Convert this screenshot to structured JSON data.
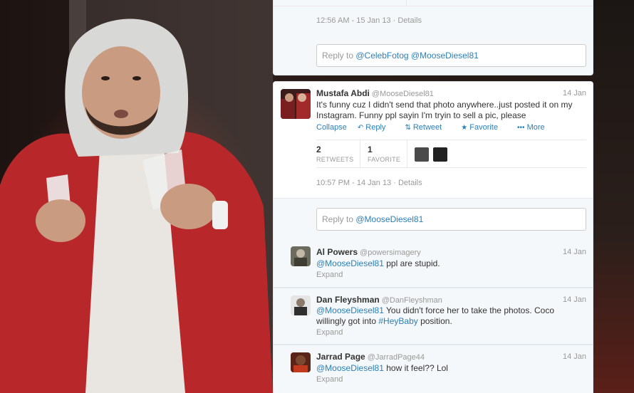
{
  "colors": {
    "link": "#2a7fb8",
    "muted": "#999999",
    "text": "#333333",
    "background_photo": "#3a1a16"
  },
  "top_tweet": {
    "timestamp": "12:56 AM - 15 Jan 13 · Details",
    "reply_prefix": "Reply to",
    "reply_mentions": "@CelebFotog @MooseDiesel81"
  },
  "main_tweet": {
    "name": "Mustafa Abdi",
    "handle": "@MooseDiesel81",
    "date": "14 Jan",
    "text_line1": "It's funny cuz I didn't send that photo anywhere..just posted it on my",
    "text_line2": "Instagram. Funny ppl sayin I'm tryin to sell a pic, please",
    "actions": {
      "collapse": "Collapse",
      "reply": "Reply",
      "retweet": "Retweet",
      "favorite": "Favorite",
      "more": "More"
    },
    "action_icons": [
      "reply-arrow-icon",
      "retweet-icon",
      "star-icon",
      "ellipsis-icon"
    ],
    "stats": {
      "retweets_count": "2",
      "retweets_label": "RETWEETS",
      "favorites_count": "1",
      "favorites_label": "FAVORITE"
    },
    "timestamp": "10:57 PM - 14 Jan 13 · Details",
    "reply_prefix": "Reply to",
    "reply_mentions": "@MooseDiesel81"
  },
  "replies": [
    {
      "name": "Al Powers",
      "handle": "@powersimagery",
      "date": "14 Jan",
      "mention": "@MooseDiesel81",
      "text": " ppl are stupid.",
      "expand": "Expand"
    },
    {
      "name": "Dan Fleyshman",
      "handle": "@DanFleyshman",
      "date": "14 Jan",
      "mention": "@MooseDiesel81",
      "text": " You didn't force her to take the photos. Coco",
      "text_line2_prefix": "willingly got into ",
      "hashtag": "#HeyBaby",
      "text_line2_suffix": " position.",
      "expand": "Expand"
    },
    {
      "name": "Jarrad Page",
      "handle": "@JarradPage44",
      "date": "14 Jan",
      "mention": "@MooseDiesel81",
      "text": " how it feel?? Lol",
      "expand": "Expand"
    }
  ]
}
